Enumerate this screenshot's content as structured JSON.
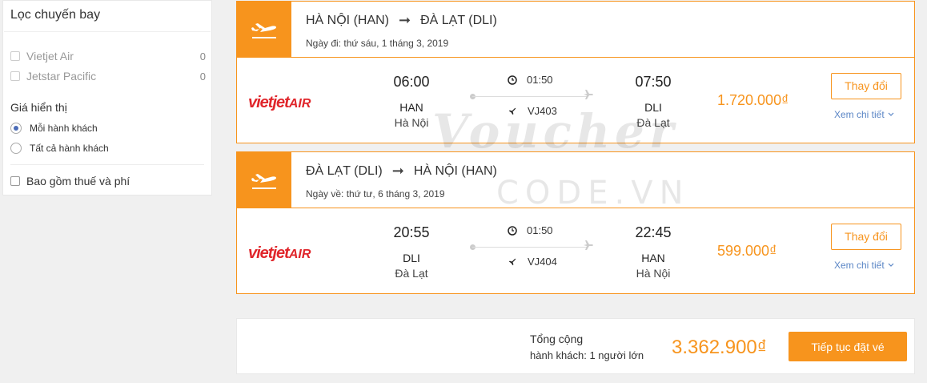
{
  "sidebar": {
    "title": "Lọc chuyến bay",
    "airlines": [
      {
        "name": "Vietjet Air",
        "count": "0"
      },
      {
        "name": "Jetstar Pacific",
        "count": "0"
      }
    ],
    "price_display_title": "Giá hiển thị",
    "price_options": [
      {
        "label": "Mỗi hành khách",
        "selected": true
      },
      {
        "label": "Tất cả hành khách",
        "selected": false
      }
    ],
    "include_tax_label": "Bao gồm thuế và phí"
  },
  "flights": [
    {
      "from": "HÀ NỘI (HAN)",
      "to": "ĐÀ LẠT (DLI)",
      "date": "Ngày đi: thứ sáu, 1 tháng 3, 2019",
      "airline_logo": "vietjetAIR",
      "airline_logo_main": "vietjet",
      "airline_logo_air": "AIR",
      "dep_time": "06:00",
      "dep_code": "HAN",
      "dep_city": "Hà Nội",
      "duration": "01:50",
      "flight_no": "VJ403",
      "arr_time": "07:50",
      "arr_code": "DLI",
      "arr_city": "Đà Lạt",
      "price": "1.720.000₫",
      "change_label": "Thay đổi",
      "detail_label": "Xem chi tiết"
    },
    {
      "from": "ĐÀ LẠT (DLI)",
      "to": "HÀ NỘI (HAN)",
      "date": "Ngày về: thứ tư, 6 tháng 3, 2019",
      "airline_logo": "vietjetAIR",
      "airline_logo_main": "vietjet",
      "airline_logo_air": "AIR",
      "dep_time": "20:55",
      "dep_code": "DLI",
      "dep_city": "Đà Lạt",
      "duration": "01:50",
      "flight_no": "VJ404",
      "arr_time": "22:45",
      "arr_code": "HAN",
      "arr_city": "Hà Nội",
      "price": "599.000₫",
      "change_label": "Thay đổi",
      "detail_label": "Xem chi tiết"
    }
  ],
  "total": {
    "label": "Tổng cộng",
    "passengers": "hành khách: 1 người lớn",
    "price": "3.362.900₫",
    "continue_label": "Tiếp tục đặt vé"
  },
  "watermark": {
    "script": "Voucher",
    "code": "CODE.VN"
  },
  "colors": {
    "accent": "#f7941d",
    "airline_red": "#e0262b",
    "link": "#5b86c6"
  }
}
